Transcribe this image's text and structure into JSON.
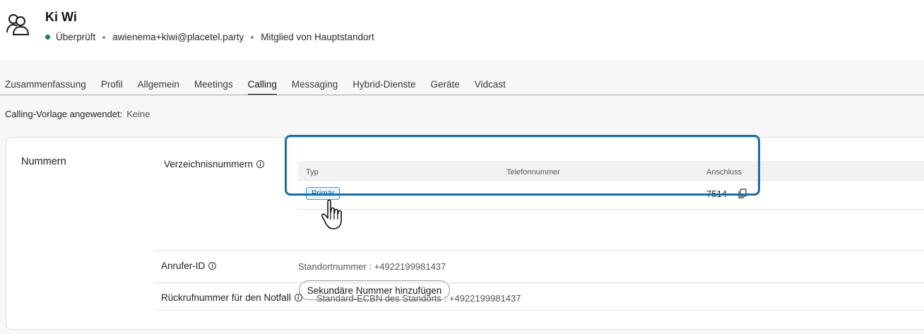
{
  "header": {
    "name": "Ki Wi",
    "status": "Überprüft",
    "email": "awienema+kiwi@placetel.party",
    "membership": "Mitglied von Hauptstandort"
  },
  "tabs": [
    {
      "label": "Zusammenfassung",
      "active": false
    },
    {
      "label": "Profil",
      "active": false
    },
    {
      "label": "Allgemein",
      "active": false
    },
    {
      "label": "Meetings",
      "active": false
    },
    {
      "label": "Calling",
      "active": true
    },
    {
      "label": "Messaging",
      "active": false
    },
    {
      "label": "Hybrid-Dienste",
      "active": false
    },
    {
      "label": "Geräte",
      "active": false
    },
    {
      "label": "Vidcast",
      "active": false
    }
  ],
  "template": {
    "label": "Calling-Vorlage angewendet:",
    "value": "Keine"
  },
  "numbers": {
    "section_title": "Nummern",
    "directory_label": "Verzeichnisnummern",
    "columns": [
      "Typ",
      "Telefonnummer",
      "Anschluss"
    ],
    "rows": [
      {
        "type": "Primär",
        "phone": "",
        "extension": "7514"
      }
    ],
    "add_button": "Sekundäre Nummer hinzufügen",
    "caller_id_label": "Anrufer-ID",
    "caller_id_value": "Standortnummer : +4922199981437",
    "ecbn_label": "Rückrufnummer für den Notfall",
    "ecbn_value": "Standard-ECBN des Standorts : +4922199981437"
  },
  "icons": {
    "avatar": "users-icon",
    "info": "info-icon",
    "copy": "copy-icon",
    "cursor": "hand-pointer-icon"
  },
  "colors": {
    "status_green": "#1d7f4e",
    "highlight_blue": "#1b6fa8",
    "badge_blue": "#3b9fd6"
  }
}
